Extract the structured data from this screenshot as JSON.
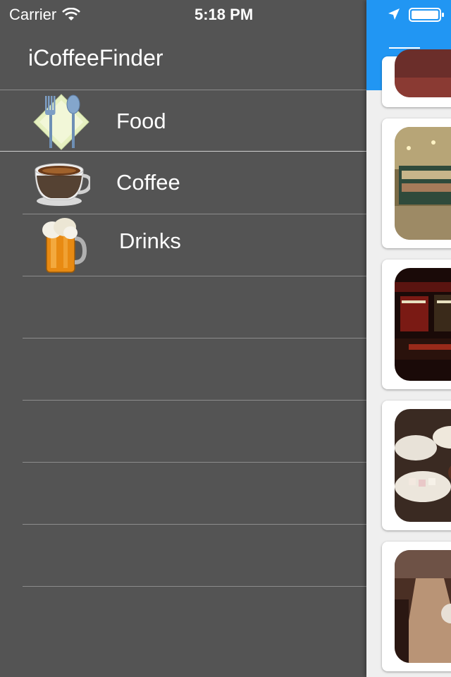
{
  "status_bar": {
    "carrier": "Carrier",
    "time": "5:18 PM"
  },
  "menu": {
    "title": "iCoffeeFinder",
    "items": [
      {
        "label": "Food",
        "icon": "cutlery-icon"
      },
      {
        "label": "Coffee",
        "icon": "coffee-cup-icon"
      },
      {
        "label": "Drinks",
        "icon": "beer-mug-icon"
      }
    ],
    "empty_rows": 6
  },
  "content": {
    "accent_color": "#2196f3",
    "cards": [
      {
        "image": "photo-thumbnail"
      },
      {
        "image": "bakery-display-photo"
      },
      {
        "image": "bar-interior-photo"
      },
      {
        "image": "dessert-plates-photo"
      },
      {
        "image": "cafe-counter-photo"
      }
    ]
  }
}
